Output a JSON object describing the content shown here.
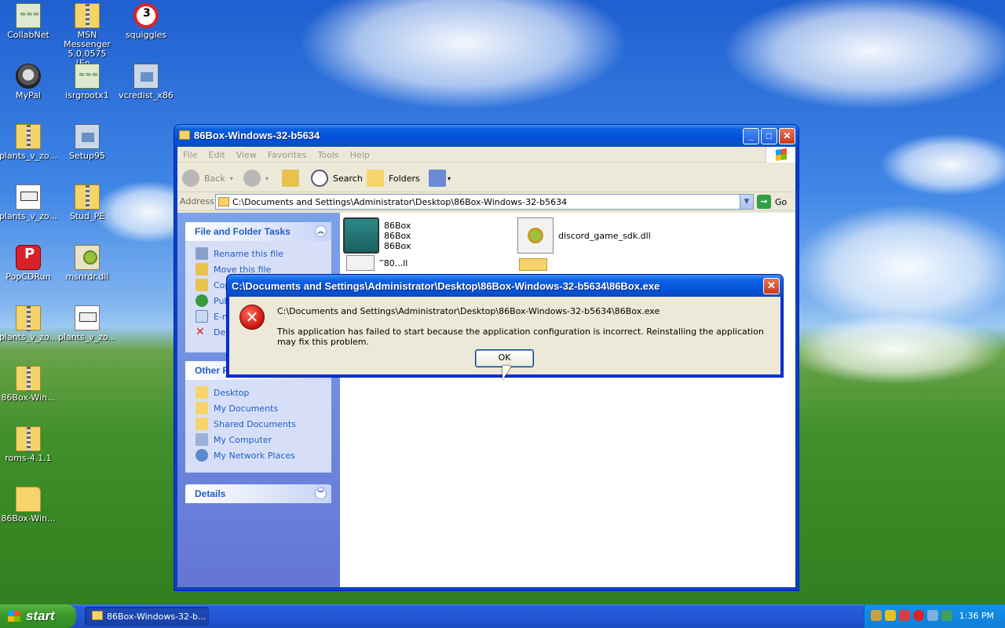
{
  "desktop_icons": [
    {
      "label": "CollabNet",
      "icon": "certificate-icon"
    },
    {
      "label": "MSN Messenger 5.0.0575 (En...",
      "icon": "zip-folder-icon"
    },
    {
      "label": "squiggles",
      "icon": "squiggles-icon"
    },
    {
      "label": "MyPal",
      "icon": "raccoon-icon"
    },
    {
      "label": "isrgrootx1",
      "icon": "certificate-icon"
    },
    {
      "label": "vcredist_x86",
      "icon": "installer-icon"
    },
    {
      "label": "plants_v_zo...",
      "icon": "zip-folder-icon"
    },
    {
      "label": "Setup95",
      "icon": "setup-icon"
    },
    {
      "label": "plants_v_zo...",
      "icon": "document-icon"
    },
    {
      "label": "Stud_PE",
      "icon": "zip-folder-icon"
    },
    {
      "label": "PopCDRun",
      "icon": "popcdrun-icon"
    },
    {
      "label": "msnrdr.dll",
      "icon": "dll-icon"
    },
    {
      "label": "plants_v_zo...",
      "icon": "zip-folder-icon"
    },
    {
      "label": "plants_v_zo...",
      "icon": "document-icon"
    },
    {
      "label": "86Box-Win...",
      "icon": "zip-folder-icon"
    },
    {
      "label": "roms-4.1.1",
      "icon": "zip-folder-icon"
    },
    {
      "label": "86Box-Win...",
      "icon": "folder-icon"
    }
  ],
  "explorer": {
    "title": "86Box-Windows-32-b5634",
    "menu": [
      "File",
      "Edit",
      "View",
      "Favorites",
      "Tools",
      "Help"
    ],
    "toolbar": {
      "back": "Back",
      "search": "Search",
      "folders": "Folders"
    },
    "address_label": "Address",
    "address_value": "C:\\Documents and Settings\\Administrator\\Desktop\\86Box-Windows-32-b5634",
    "go_label": "Go",
    "file_tasks": {
      "title": "File and Folder Tasks",
      "items": [
        "Rename this file",
        "Move this file",
        "Cop",
        "Pub",
        "E-m",
        "Dele"
      ]
    },
    "other_places": {
      "title": "Other P",
      "items": [
        "Desktop",
        "My Documents",
        "Shared Documents",
        "My Computer",
        "My Network Places"
      ]
    },
    "details": {
      "title": "Details"
    },
    "files": [
      {
        "name": "86Box",
        "line2": "86Box",
        "line3": "86Box",
        "icon": "86box-computer-icon"
      },
      {
        "name": "discord_game_sdk.dll",
        "icon": "dll-icon"
      },
      {
        "name": "‴80...ll",
        "icon": "dll-icon"
      }
    ]
  },
  "dialog": {
    "title": "C:\\Documents and Settings\\Administrator\\Desktop\\86Box-Windows-32-b5634\\86Box.exe",
    "path_line": "C:\\Documents and Settings\\Administrator\\Desktop\\86Box-Windows-32-b5634\\86Box.exe",
    "message": "This application has failed to start because the application configuration is incorrect. Reinstalling the application may fix this problem.",
    "ok_label": "OK"
  },
  "taskbar": {
    "start_label": "start",
    "window_button": "86Box-Windows-32-b...",
    "clock": "1:36 PM"
  }
}
